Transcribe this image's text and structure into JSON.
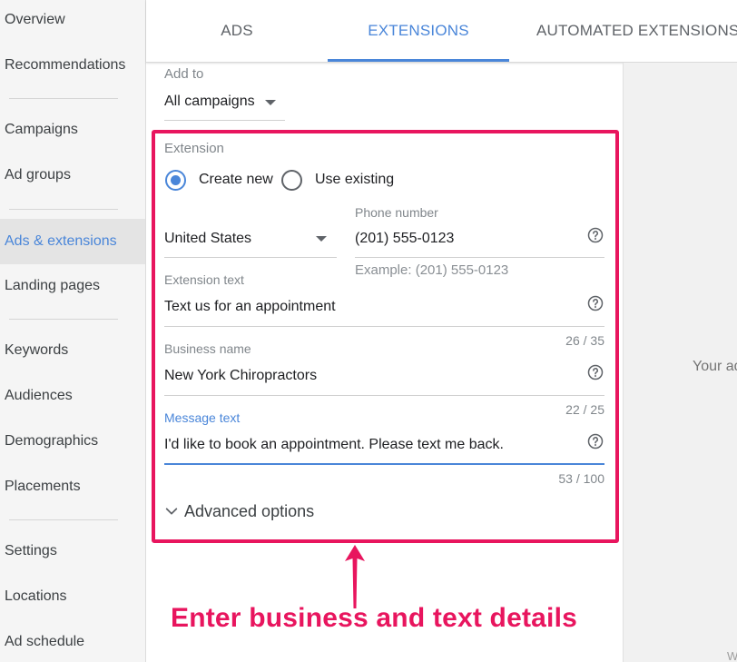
{
  "sidebar": {
    "items": [
      {
        "label": "Overview"
      },
      {
        "label": "Recommendations"
      },
      {
        "label": "Campaigns"
      },
      {
        "label": "Ad groups"
      },
      {
        "label": "Ads & extensions"
      },
      {
        "label": "Landing pages"
      },
      {
        "label": "Keywords"
      },
      {
        "label": "Audiences"
      },
      {
        "label": "Demographics"
      },
      {
        "label": "Placements"
      },
      {
        "label": "Settings"
      },
      {
        "label": "Locations"
      },
      {
        "label": "Ad schedule"
      }
    ],
    "active_item": "Ads & extensions"
  },
  "tabs": [
    {
      "label": "ADS"
    },
    {
      "label": "EXTENSIONS"
    },
    {
      "label": "AUTOMATED EXTENSIONS"
    }
  ],
  "active_tab": "EXTENSIONS",
  "add_to": {
    "label": "Add to",
    "value": "All campaigns"
  },
  "extension": {
    "label": "Extension",
    "options": [
      {
        "label": "Create new",
        "checked": true
      },
      {
        "label": "Use existing",
        "checked": false
      }
    ]
  },
  "country": {
    "value": "United States"
  },
  "phone": {
    "label": "Phone number",
    "value": "(201) 555-0123",
    "hint": "Example: (201) 555-0123"
  },
  "extension_text": {
    "label": "Extension text",
    "value": "Text us for an appointment",
    "counter": "26 / 35"
  },
  "business_name": {
    "label": "Business name",
    "value": "New York Chiropractors",
    "counter": "22 / 25"
  },
  "message_text": {
    "label": "Message text",
    "value": "I'd like to book an appointment. Please text me back.",
    "counter": "53 / 100"
  },
  "advanced_options": {
    "label": "Advanced options"
  },
  "preview": {
    "text": "Your ad",
    "footer": "W"
  },
  "annotation": {
    "text": "Enter business and text details"
  },
  "colors": {
    "accent": "#4a86d9",
    "highlight": "#e8155e"
  }
}
